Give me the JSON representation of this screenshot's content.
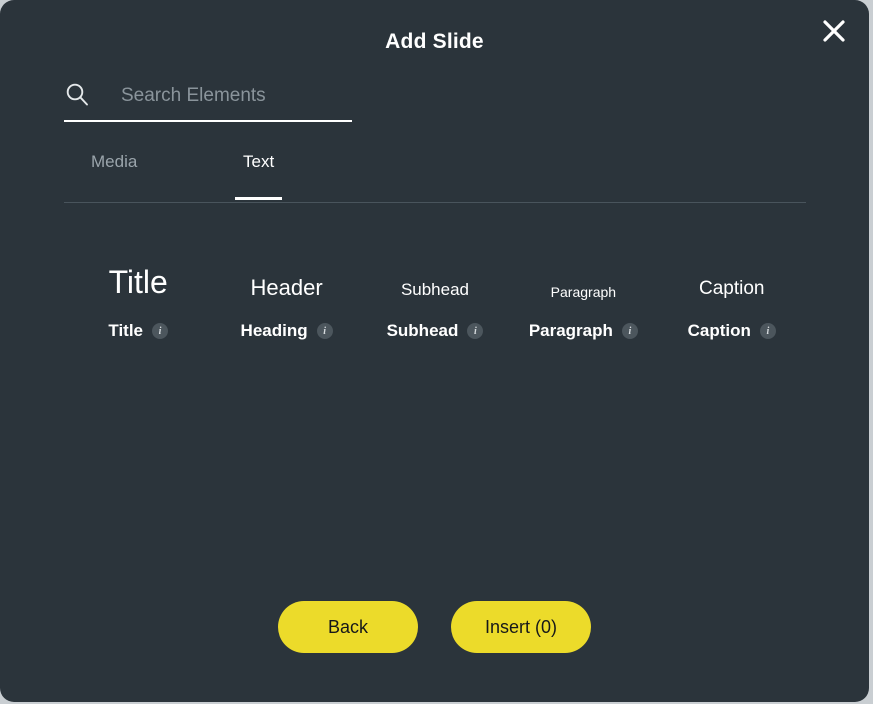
{
  "modal": {
    "title": "Add Slide",
    "close_icon": "close-icon",
    "accent_color": "#ecdb2a",
    "background_color": "#2b343b"
  },
  "search": {
    "icon": "search-icon",
    "placeholder": "Search Elements",
    "value": ""
  },
  "tabs": [
    {
      "label": "Media",
      "active": false
    },
    {
      "label": "Text",
      "active": true
    }
  ],
  "elements": [
    {
      "preview": "Title",
      "label": "Title",
      "info_icon": "i"
    },
    {
      "preview": "Header",
      "label": "Heading",
      "info_icon": "i"
    },
    {
      "preview": "Subhead",
      "label": "Subhead",
      "info_icon": "i"
    },
    {
      "preview": "Paragraph",
      "label": "Paragraph",
      "info_icon": "i"
    },
    {
      "preview": "Caption",
      "label": "Caption",
      "info_icon": "i"
    }
  ],
  "footer": {
    "back_label": "Back",
    "insert_label": "Insert (0)"
  }
}
